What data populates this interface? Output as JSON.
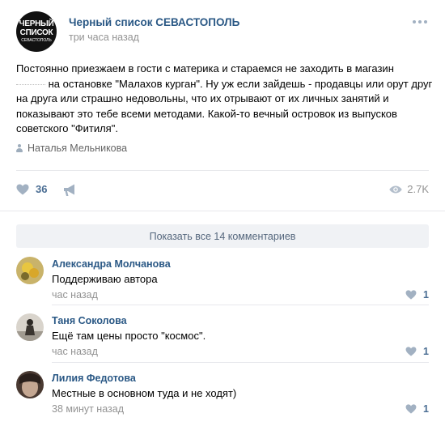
{
  "post": {
    "avatar": {
      "line1": "ЧЕРНЫЙ",
      "line2": "СПИСОК",
      "line3": "СЕВАСТОПОЛЬ"
    },
    "author": "Черный список СЕВАСТОПОЛЬ",
    "time": "три часа назад",
    "text_part1": "Постоянно приезжаем в гости с материка и стараемся не заходить в магазин",
    "text_part2": " на остановке \"Малахов курган\". Ну уж если зайдешь - продавцы или орут друг на друга или страшно недовольны, что их отрывают от их личных занятий и показывают это тебе всеми методами. Какой-то вечный островок из выпусков советского \"Фитиля\".",
    "signer": "Наталья Мельникова",
    "likes": "36",
    "views": "2.7K"
  },
  "comments_block": {
    "show_all_label": "Показать все 14 комментариев",
    "items": [
      {
        "name": "Александра Молчанова",
        "text": "Поддерживаю автора",
        "time": "час назад",
        "likes": "1"
      },
      {
        "name": "Таня Соколова",
        "text": "Ещё там цены просто \"космос\".",
        "time": "час назад",
        "likes": "1"
      },
      {
        "name": "Лилия Федотова",
        "text": "Местные в основном туда и не ходят)",
        "time": "38 минут назад",
        "likes": "1"
      }
    ]
  },
  "icons": {
    "more": "more-icon",
    "user": "user-icon",
    "like": "heart-icon",
    "share": "megaphone-icon",
    "views": "eye-icon"
  },
  "colors": {
    "link": "#2a5885",
    "muted": "#939393",
    "icon": "#a2b1c2",
    "button_bg": "#f0f2f5"
  }
}
